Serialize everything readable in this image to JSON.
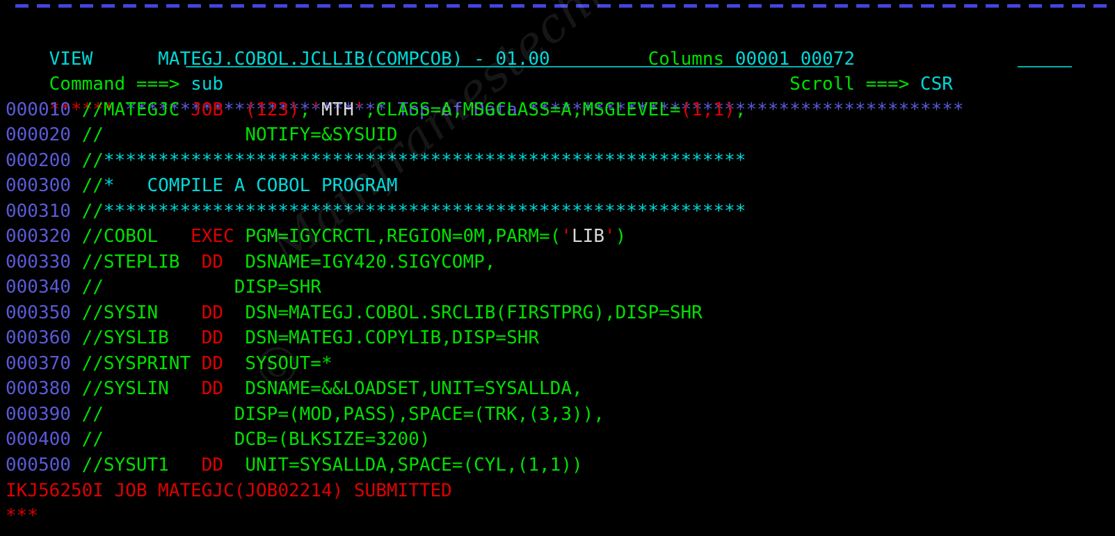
{
  "terminal": {
    "type": "ispf-view-panel",
    "cols": 80,
    "rows": 21,
    "char_width": 19.55,
    "line_height": 36.5,
    "background": "#000000",
    "colors": {
      "green": "#00e000",
      "red": "#dd0000",
      "turquoise": "#00d8d8",
      "blue": "#5a5ad8",
      "white": "#d8d8d8",
      "underline": "#00b0b0",
      "dash_rule": "#4444dd"
    }
  },
  "watermark": {
    "text": "Mainframestechhelp",
    "copyright_symbol": "©"
  },
  "header": {
    "panel_name": "VIEW",
    "dataset": "MATEGJ.COBOL.JCLLIB(COMPCOB)",
    "separator": "-",
    "version": "01.00",
    "columns_label": "Columns",
    "columns_from": "00001",
    "columns_to": "00072"
  },
  "command_line": {
    "label": "Command ===>",
    "value": "sub",
    "placeholder": ""
  },
  "scroll_field": {
    "label": "Scroll ===>",
    "value": "CSR"
  },
  "top_of_data": {
    "prefix_stars": "******",
    "left_stars": "************************",
    "label": "Top of Data",
    "right_stars": "****************************************"
  },
  "editor_lines": [
    {
      "number": "000010",
      "segments": [
        {
          "text": "//MATEGJC ",
          "color": "green"
        },
        {
          "text": "JOB  (123)",
          "color": "red"
        },
        {
          "text": ",",
          "color": "green"
        },
        {
          "text": "'",
          "color": "red"
        },
        {
          "text": "MTH",
          "color": "white"
        },
        {
          "text": "'",
          "color": "red"
        },
        {
          "text": ",CLASS=A,MSGCLASS=A,MSGLEVEL=",
          "color": "green"
        },
        {
          "text": "(1,1)",
          "color": "red"
        },
        {
          "text": ",",
          "color": "green"
        }
      ]
    },
    {
      "number": "000020",
      "segments": [
        {
          "text": "//             NOTIFY=&SYSUID",
          "color": "green"
        }
      ]
    },
    {
      "number": "000200",
      "segments": [
        {
          "text": "//",
          "color": "green"
        },
        {
          "text": "***********************************************************",
          "color": "turquoise"
        }
      ]
    },
    {
      "number": "000300",
      "segments": [
        {
          "text": "//",
          "color": "green"
        },
        {
          "text": "*   COMPILE A COBOL PROGRAM",
          "color": "turquoise"
        }
      ]
    },
    {
      "number": "000310",
      "segments": [
        {
          "text": "//",
          "color": "green"
        },
        {
          "text": "***********************************************************",
          "color": "turquoise"
        }
      ]
    },
    {
      "number": "000320",
      "segments": [
        {
          "text": "//COBOL   ",
          "color": "green"
        },
        {
          "text": "EXEC",
          "color": "red"
        },
        {
          "text": " PGM=IGYCRCTL,REGION=0M,PARM=(",
          "color": "green"
        },
        {
          "text": "'",
          "color": "red"
        },
        {
          "text": "LIB",
          "color": "white"
        },
        {
          "text": "'",
          "color": "red"
        },
        {
          "text": ")",
          "color": "green"
        }
      ]
    },
    {
      "number": "000330",
      "segments": [
        {
          "text": "//STEPLIB  ",
          "color": "green"
        },
        {
          "text": "DD",
          "color": "red"
        },
        {
          "text": "  DSNAME=IGY420.SIGYCOMP,",
          "color": "green"
        }
      ]
    },
    {
      "number": "000340",
      "segments": [
        {
          "text": "//            DISP=SHR",
          "color": "green"
        }
      ]
    },
    {
      "number": "000350",
      "segments": [
        {
          "text": "//SYSIN    ",
          "color": "green"
        },
        {
          "text": "DD",
          "color": "red"
        },
        {
          "text": "  DSN=MATEGJ.COBOL.SRCLIB(FIRSTPRG),DISP=SHR",
          "color": "green"
        }
      ]
    },
    {
      "number": "000360",
      "segments": [
        {
          "text": "//SYSLIB   ",
          "color": "green"
        },
        {
          "text": "DD",
          "color": "red"
        },
        {
          "text": "  DSN=MATEGJ.COPYLIB,DISP=SHR",
          "color": "green"
        }
      ]
    },
    {
      "number": "000370",
      "segments": [
        {
          "text": "//SYSPRINT ",
          "color": "green"
        },
        {
          "text": "DD",
          "color": "red"
        },
        {
          "text": "  SYSOUT=*",
          "color": "green"
        }
      ]
    },
    {
      "number": "000380",
      "segments": [
        {
          "text": "//SYSLIN   ",
          "color": "green"
        },
        {
          "text": "DD",
          "color": "red"
        },
        {
          "text": "  DSNAME=&&LOADSET,UNIT=SYSALLDA,",
          "color": "green"
        }
      ]
    },
    {
      "number": "000390",
      "segments": [
        {
          "text": "//            DISP=(MOD,PASS),SPACE=(TRK,(3,3)),",
          "color": "green"
        }
      ]
    },
    {
      "number": "000400",
      "segments": [
        {
          "text": "//            DCB=(BLKSIZE=3200)",
          "color": "green"
        }
      ]
    },
    {
      "number": "000500",
      "segments": [
        {
          "text": "//SYSUT1   ",
          "color": "green"
        },
        {
          "text": "DD",
          "color": "red"
        },
        {
          "text": "  UNIT=SYSALLDA,SPACE=(CYL,(1,1))",
          "color": "green"
        }
      ]
    }
  ],
  "message_line": {
    "text": "IKJ56250I JOB MATEGJC(JOB02214) SUBMITTED",
    "color": "red"
  },
  "bottom_line": {
    "text": "***",
    "color": "red"
  }
}
